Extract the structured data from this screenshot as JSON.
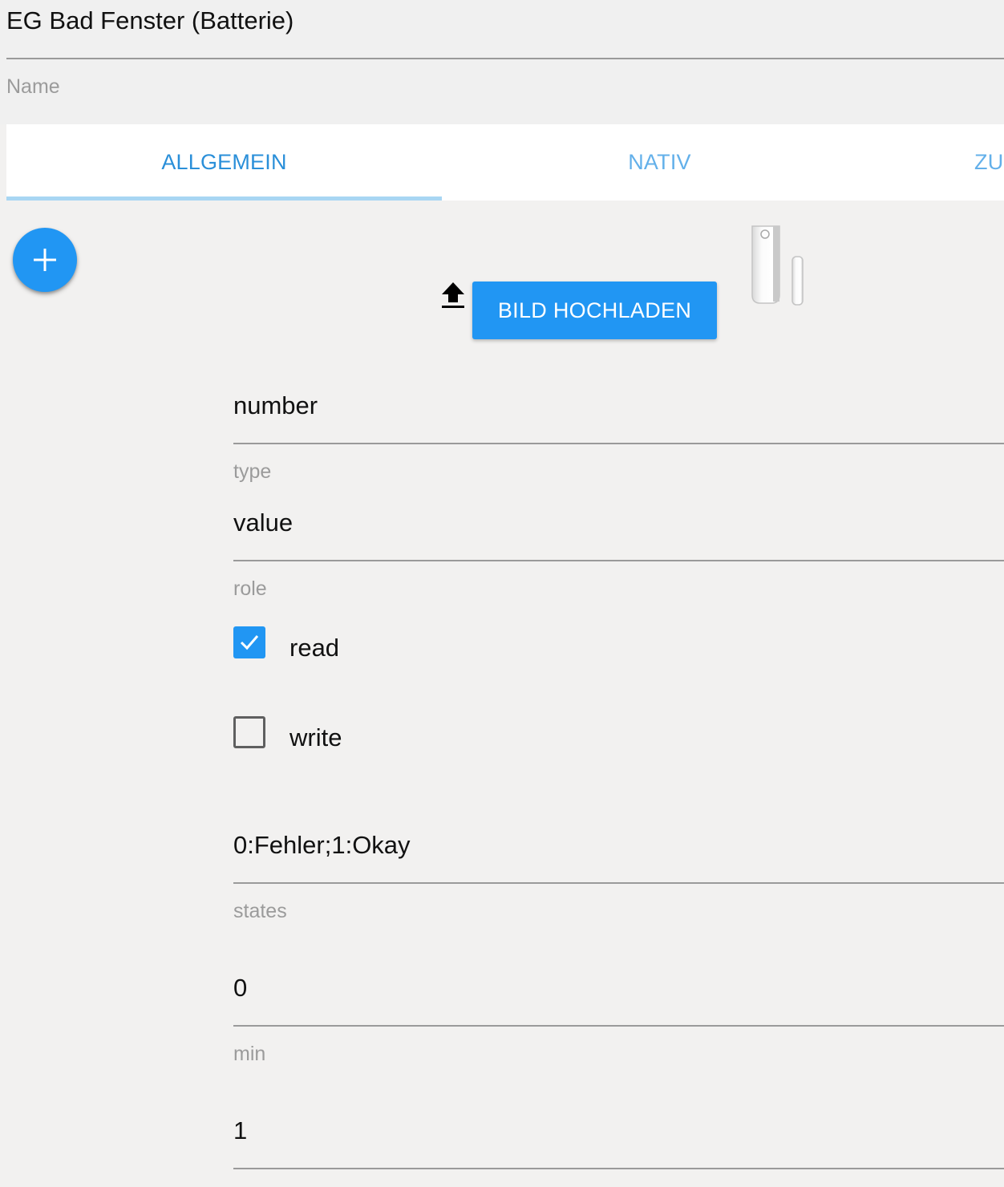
{
  "header": {
    "name_value": "EG Bad Fenster (Batterie)",
    "name_label": "Name"
  },
  "tabs": [
    {
      "label": "ALLGEMEIN",
      "active": true
    },
    {
      "label": "NATIV",
      "active": false
    },
    {
      "label": "ZU",
      "active": false
    }
  ],
  "toolbar": {
    "add_icon": "plus-icon",
    "upload_icon": "upload-icon",
    "upload_label": "BILD HOCHLADEN"
  },
  "fields": {
    "type": {
      "value": "number",
      "label": "type"
    },
    "role": {
      "value": "value",
      "label": "role"
    },
    "read": {
      "label": "read",
      "checked": true
    },
    "write": {
      "label": "write",
      "checked": false
    },
    "states": {
      "value": "0:Fehler;1:Okay",
      "label": "states"
    },
    "min": {
      "value": "0",
      "label": "min"
    },
    "max": {
      "value": "1"
    }
  },
  "colors": {
    "accent": "#2196f3",
    "tab_active": "#2a8fd9",
    "tab_inactive": "#63b0ea",
    "label_gray": "#9b9b9b",
    "background": "#f2f1f0"
  }
}
